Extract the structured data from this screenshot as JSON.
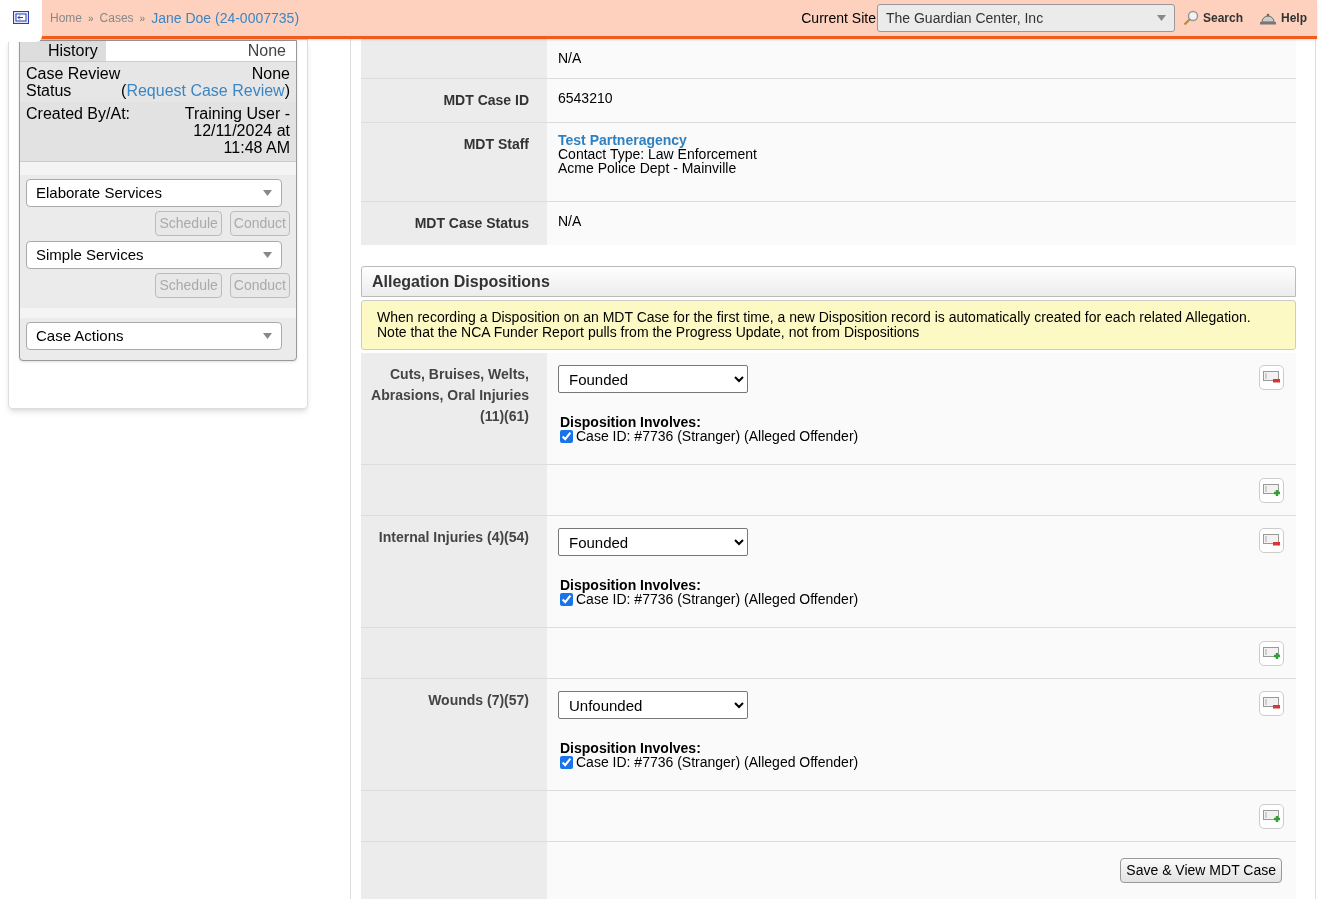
{
  "header": {
    "separator": "»",
    "breadcrumbs": [
      {
        "label": "Home",
        "current": false
      },
      {
        "label": "Cases",
        "current": false
      },
      {
        "label": "Jane Doe (24-0007735)",
        "current": true
      }
    ],
    "site_label": "Current Site",
    "site": "The Guardian Center, Inc",
    "search": "Search",
    "help": "Help"
  },
  "sidebar": {
    "history": {
      "label": "History",
      "value": "None"
    },
    "review": {
      "label": "Case Review Status",
      "value": "None (",
      "link": "Request Case Review",
      "after": ")"
    },
    "created": {
      "label": "Created By/At:",
      "value": "Training User - 12/11/2024 at 11:48 AM"
    },
    "services": [
      {
        "select": "Elaborate Services",
        "buttons": [
          {
            "label": "Schedule",
            "disabled": true
          },
          {
            "label": "Conduct",
            "disabled": true
          }
        ]
      },
      {
        "select": "Simple Services",
        "buttons": [
          {
            "label": "Schedule",
            "disabled": true
          },
          {
            "label": "Conduct",
            "disabled": true
          }
        ]
      }
    ],
    "case_actions": "Case Actions"
  },
  "mdt_rows": [
    {
      "kind": "text",
      "value": "N/A"
    },
    {
      "kind": "text",
      "label": "MDT Case ID",
      "value": "6543210"
    },
    {
      "kind": "staff",
      "label": "MDT Staff",
      "link": "Test Partneragency",
      "lines": [
        "Contact Type: Law Enforcement",
        "Acme Police Dept - Mainville"
      ]
    },
    {
      "kind": "text",
      "label": "MDT Case Status",
      "value": "N/A"
    }
  ],
  "dispositions": {
    "title": "Allegation Dispositions",
    "notice": [
      "When recording a Disposition on an MDT Case for the first time, a new Disposition record is automatically created for each related Allegation.",
      "Note that the NCA Funder Report pulls from the Progress Update, not from Dispositions"
    ],
    "allegations": [
      {
        "label": "Cuts, Bruises, Welts, Abrasions, Oral Injuries (11)(61)",
        "disposition": "Founded",
        "involves_label": "Disposition Involves:",
        "parties": [
          {
            "text": "Case ID: #7736 (Stranger) (Alleged Offender)",
            "checked": true
          }
        ]
      },
      {
        "label": "Internal Injuries (4)(54)",
        "disposition": "Founded",
        "involves_label": "Disposition Involves:",
        "parties": [
          {
            "text": "Case ID: #7736 (Stranger) (Alleged Offender)",
            "checked": true
          }
        ]
      },
      {
        "label": "Wounds (7)(57)",
        "disposition": "Unfounded",
        "involves_label": "Disposition Involves:",
        "parties": [
          {
            "text": "Case ID: #7736 (Stranger) (Alleged Offender)",
            "checked": true
          }
        ]
      }
    ],
    "save": "Save & View MDT Case"
  }
}
